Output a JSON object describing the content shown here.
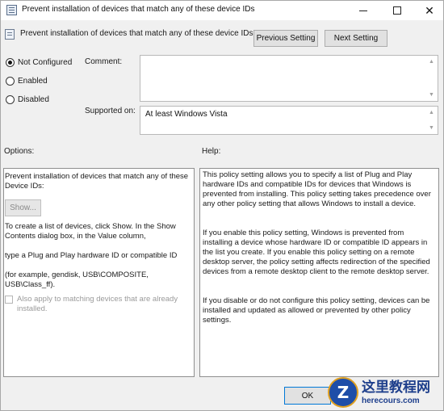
{
  "window": {
    "title": "Prevent installation of devices that match any of these device IDs"
  },
  "header": {
    "policy_name": "Prevent installation of devices that match any of these device IDs",
    "previous_label": "Previous Setting",
    "next_label": "Next Setting"
  },
  "state": {
    "options": [
      "Not Configured",
      "Enabled",
      "Disabled"
    ],
    "selected": "Not Configured"
  },
  "comment": {
    "label": "Comment:",
    "value": ""
  },
  "supported": {
    "label": "Supported on:",
    "value": "At least Windows Vista"
  },
  "options_section": {
    "label": "Options:",
    "description": "Prevent installation of devices that match any of these Device IDs:",
    "show_label": "Show...",
    "instructions": "To create a list of devices, click Show. In the Show Contents dialog box, in the Value column,",
    "type_hint": "type a Plug and Play hardware ID or compatible ID",
    "example": "(for example, gendisk, USB\\COMPOSITE, USB\\Class_ff).",
    "also_apply_label": "Also apply to matching devices that are already installed."
  },
  "help_section": {
    "label": "Help:",
    "p1": "This policy setting allows you to specify a list of Plug and Play hardware IDs and compatible IDs for devices that Windows is prevented from installing. This policy setting takes precedence over any other policy setting that allows Windows to install a device.",
    "p2": "If you enable this policy setting, Windows is prevented from installing a device whose hardware ID or compatible ID appears in the list you create. If you enable this policy setting on a remote desktop server, the policy setting affects redirection of the specified devices from a remote desktop client to the remote desktop server.",
    "p3": "If you disable or do not configure this policy setting, devices can be installed and updated as allowed or prevented by other policy settings."
  },
  "footer": {
    "ok_label": "OK"
  },
  "watermark": {
    "logo_letter": "Z",
    "site_name": "这里教程网",
    "site_url": "herecours.com"
  }
}
